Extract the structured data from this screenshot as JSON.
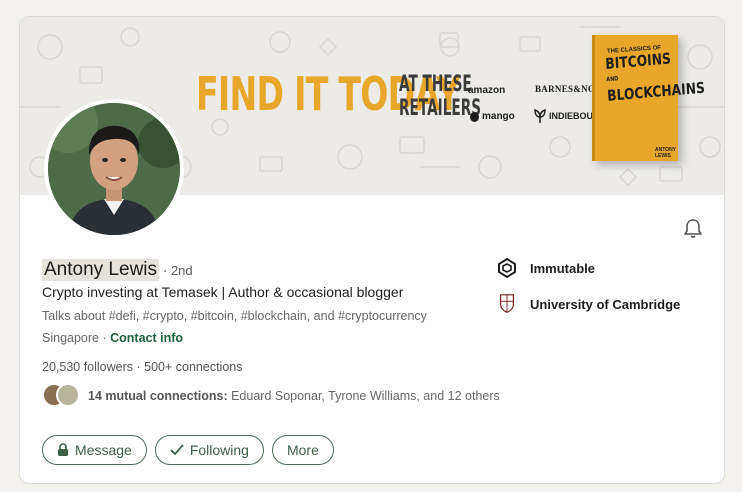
{
  "banner": {
    "headline": "FIND IT TODAY",
    "sub_line1": "AT THESE",
    "sub_line2": "RETAILERS",
    "retailers": [
      "amazon",
      "BARNES&NOBLE",
      "mango",
      "INDIEBOUND"
    ],
    "book": {
      "small_text": "THE CLASSICS OF",
      "title_line1": "BITCOINS",
      "title_amp": "AND",
      "title_line2": "BLOCKCHAINS",
      "author": "ANTONY LEWIS"
    },
    "accent_color": "#e8a72a"
  },
  "profile": {
    "name": "Antony Lewis",
    "degree": "· 2nd",
    "headline": "Crypto investing at Temasek | Author & occasional blogger",
    "talks_about": "Talks about #defi, #crypto, #bitcoin, #blockchain, and #cryptocurrency",
    "location": "Singapore",
    "location_separator": " · ",
    "contact_info": "Contact info",
    "followers": "20,530 followers",
    "stats_separator": " · ",
    "connections": "500+ connections",
    "mutual_count": "14 mutual connections:",
    "mutual_names": " Eduard Soponar, Tyrone Williams, and 12 others"
  },
  "organizations": [
    {
      "name": "Immutable",
      "icon": "immutable-logo-icon"
    },
    {
      "name": "University of Cambridge",
      "icon": "cambridge-crest-icon"
    }
  ],
  "actions": {
    "message": "Message",
    "following": "Following",
    "more": "More"
  },
  "icons": {
    "bell": "bell-icon",
    "lock": "lock-icon",
    "check": "check-icon"
  },
  "colors": {
    "button_border": "#4b6b55",
    "link": "#1d5e3c"
  }
}
